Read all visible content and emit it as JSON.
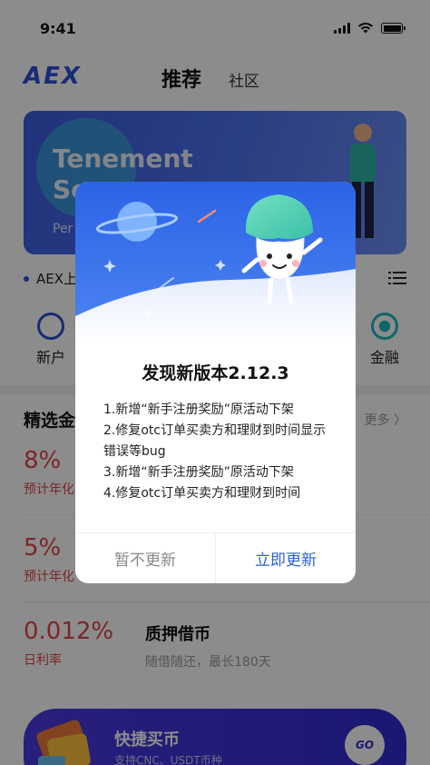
{
  "status_bar": {
    "time": "9:41"
  },
  "nav": {
    "logo": "AEX",
    "tabs": [
      {
        "label": "推荐"
      },
      {
        "label": "社区"
      }
    ]
  },
  "banner": {
    "title_line1": "Tenement",
    "title_line2": "Se",
    "subtitle": "Per"
  },
  "notice": {
    "text": "AEX上"
  },
  "quick_menu": [
    {
      "label": "新户"
    },
    {
      "label": "金融"
    }
  ],
  "section": {
    "title": "精选金",
    "more": "更多 〉"
  },
  "products": [
    {
      "rate": "8%",
      "label": "预计年化"
    },
    {
      "rate": "5%",
      "label": "预计年化"
    },
    {
      "rate": "0.012%",
      "label": "日利率",
      "name": "质押借币",
      "desc": "随借随还，最长180天"
    }
  ],
  "buy_banner": {
    "title": "快捷买币",
    "subtitle": "支持CNC、USDT币种",
    "go_label": "GO"
  },
  "modal": {
    "title": "发现新版本2.12.3",
    "lines": [
      "1.新增“新手注册奖励”原活动下架",
      "2.修复otc订单买卖方和理财到时间显示错误等bug",
      "3.新增“新手注册奖励”原活动下架",
      "4.修复otc订单买卖方和理财到时间"
    ],
    "later_label": "暂不更新",
    "update_label": "立即更新"
  },
  "colors": {
    "accent": "#2d4fd6",
    "update": "#2d5fd6",
    "rate_red": "#e0454b",
    "overlay": "rgba(0,0,0,0.45)"
  }
}
